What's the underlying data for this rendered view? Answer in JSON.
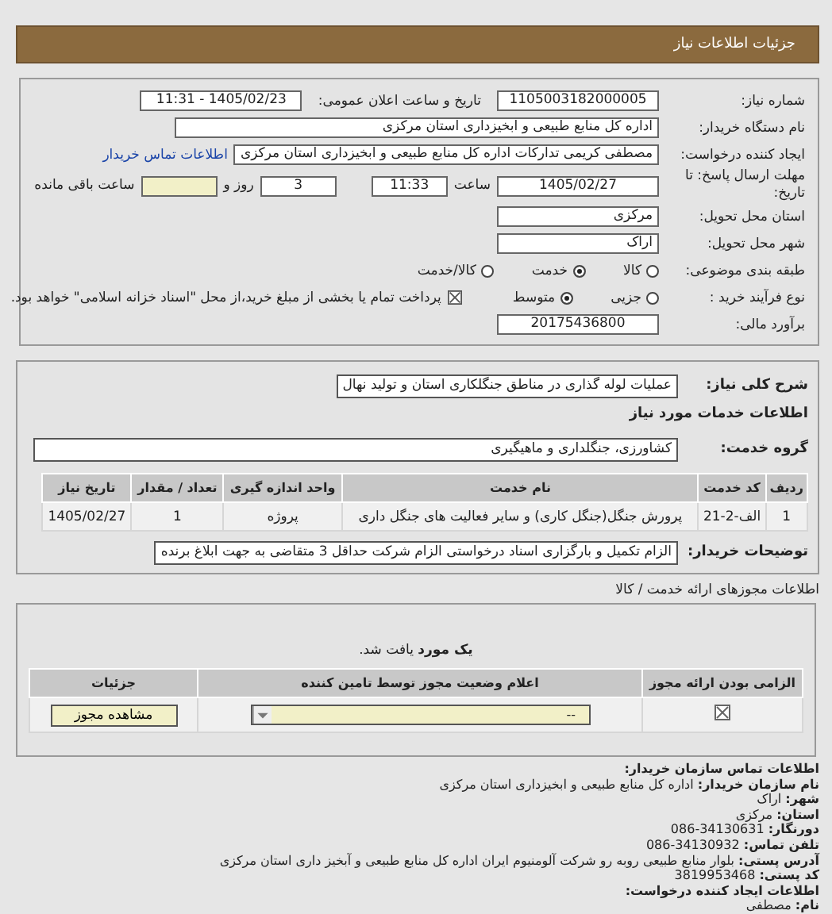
{
  "header": {
    "title": "جزئیات اطلاعات نیاز"
  },
  "need": {
    "number_label": "شماره نیاز:",
    "number": "1105003182000005",
    "announce_label": "تاریخ و ساعت اعلان عمومی:",
    "announce": "1405/02/23 - 11:31",
    "buyer_label": "نام دستگاه خریدار:",
    "buyer": "اداره کل منابع طبیعی و ابخیزداری استان مرکزی",
    "requester_label": "ایجاد کننده درخواست:",
    "requester": "مصطفی کریمی تدارکات اداره کل منابع طبیعی و ابخیزداری استان مرکزی",
    "contact_link": "اطلاعات تماس خریدار",
    "deadline_label": "مهلت ارسال پاسخ: تا تاریخ:",
    "deadline_date": "1405/02/27",
    "time_label": "ساعت",
    "deadline_time": "11:33",
    "days": "3",
    "days_label": "روز و",
    "remaining_label": "ساعت باقی مانده",
    "province_label": "استان محل تحویل:",
    "province": "مرکزی",
    "city_label": "شهر محل تحویل:",
    "city": "اراک",
    "category_label": "طبقه بندی موضوعی:",
    "categories": [
      {
        "label": "کالا",
        "selected": false
      },
      {
        "label": "خدمت",
        "selected": true
      },
      {
        "label": "کالا/خدمت",
        "selected": false
      }
    ],
    "process_label": "نوع فرآیند خرید :",
    "processes": [
      {
        "label": "جزیی",
        "selected": false
      },
      {
        "label": "متوسط",
        "selected": true
      }
    ],
    "payment": {
      "checked": true,
      "text": "پرداخت تمام یا بخشی از مبلغ خرید،از محل \"اسناد خزانه اسلامی\" خواهد بود."
    },
    "budget_label": "برآورد مالی:",
    "budget": "20175436800"
  },
  "details": {
    "description_label": "شرح کلی نیاز:",
    "description": "عملیات لوله گذاری در مناطق جنگلکاری استان و تولید نهال",
    "services_heading": "اطلاعات خدمات مورد نیاز",
    "group_label": "گروه خدمت:",
    "group": "کشاورزی، جنگلداری و ماهیگیری",
    "table": {
      "columns": [
        "ردیف",
        "کد خدمت",
        "نام خدمت",
        "واحد اندازه گیری",
        "تعداد / مقدار",
        "تاریخ نیاز"
      ],
      "rows": [
        [
          "1",
          "الف-2-21",
          "پرورش جنگل(جنگل کاری) و سایر فعالیت های جنگل داری",
          "پروژه",
          "1",
          "1405/02/27"
        ]
      ]
    },
    "notes_label": "توضیحات خریدار:",
    "notes": "الزام تکمیل و بارگزاری اسناد درخواستی الزام شرکت حداقل 3 متقاضی به جهت ابلاغ برنده"
  },
  "permits": {
    "title": "اطلاعات مجوزهای ارائه خدمت / کالا",
    "found": "**یک مورد** یافت شد.",
    "columns": [
      "الزامی بودن ارائه مجوز",
      "اعلام وضعیت مجوز توسط تامین کننده",
      "جزئیات"
    ],
    "rows": [
      {
        "required": true,
        "status": "--",
        "button": "مشاهده مجوز"
      }
    ]
  },
  "contact": {
    "title": "اطلاعات تماس سازمان خریدار:",
    "lines": [
      {
        "label": "نام سازمان خریدار:",
        "value": "اداره کل منابع طبیعی و ابخیزداری استان مرکزی"
      },
      {
        "label": "شهر:",
        "value": "اراک"
      },
      {
        "label": "استان:",
        "value": "مرکزی"
      },
      {
        "label": "دورنگار:",
        "value": "34130631-086"
      },
      {
        "label": "تلفن تماس:",
        "value": "34130932-086"
      },
      {
        "label": "آدرس پستی:",
        "value": "بلوار منابع طبیعی روبه رو شرکت آلومنیوم ایران اداره کل منابع طبیعی و آبخیز داری استان مرکزی"
      },
      {
        "label": "کد پستی:",
        "value": "3819953468"
      }
    ],
    "creator_title": "اطلاعات ایجاد کننده درخواست:",
    "creator_lines": [
      {
        "label": "نام:",
        "value": "مصطفی"
      }
    ]
  }
}
